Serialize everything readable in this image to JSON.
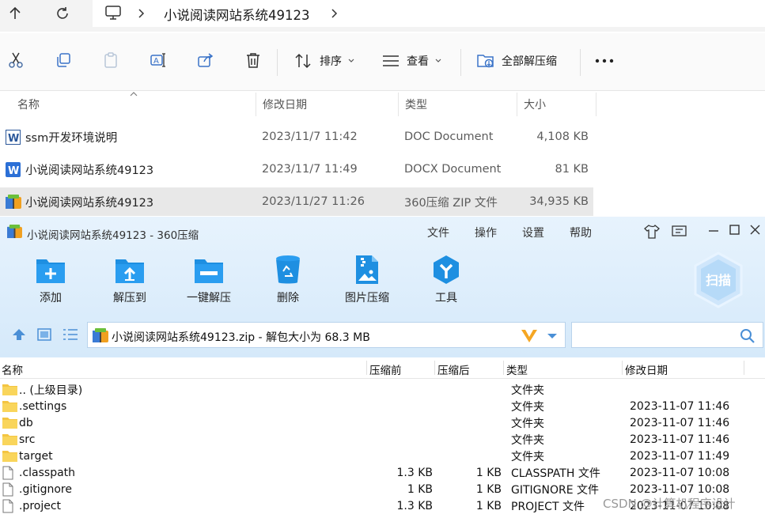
{
  "explorer": {
    "breadcrumb": [
      "小说阅读网站系统49123"
    ],
    "toolbar": {
      "sort_label": "排序",
      "view_label": "查看",
      "extract_all_label": "全部解压缩"
    },
    "columns": [
      "名称",
      "修改日期",
      "类型",
      "大小"
    ],
    "files": [
      {
        "name": "ssm开发环境说明",
        "date": "2023/11/7 11:42",
        "type": "DOC Document",
        "size": "4,108 KB",
        "icon": "word-doc-icon"
      },
      {
        "name": "小说阅读网站系统49123",
        "date": "2023/11/7 11:49",
        "type": "DOCX Document",
        "size": "81 KB",
        "icon": "word-docx-icon"
      },
      {
        "name": "小说阅读网站系统49123",
        "date": "2023/11/27 11:26",
        "type": "360压缩 ZIP 文件",
        "size": "34,935 KB",
        "icon": "zip-archive-icon"
      }
    ]
  },
  "zip": {
    "title": "小说阅读网站系统49123 - 360压缩",
    "menu": [
      "文件",
      "操作",
      "设置",
      "帮助"
    ],
    "tools": [
      "添加",
      "解压到",
      "一键解压",
      "删除",
      "图片压缩",
      "工具"
    ],
    "scan_label": "扫描",
    "path": "小说阅读网站系统49123.zip - 解包大小为 68.3 MB",
    "columns": [
      "名称",
      "压缩前",
      "压缩后",
      "类型",
      "修改日期"
    ],
    "rows": [
      {
        "name": ".. (上级目录)",
        "before": "",
        "after": "",
        "type": "文件夹",
        "date": "",
        "kind": "folder"
      },
      {
        "name": ".settings",
        "before": "",
        "after": "",
        "type": "文件夹",
        "date": "2023-11-07 11:46",
        "kind": "folder"
      },
      {
        "name": "db",
        "before": "",
        "after": "",
        "type": "文件夹",
        "date": "2023-11-07 11:46",
        "kind": "folder"
      },
      {
        "name": "src",
        "before": "",
        "after": "",
        "type": "文件夹",
        "date": "2023-11-07 11:46",
        "kind": "folder"
      },
      {
        "name": "target",
        "before": "",
        "after": "",
        "type": "文件夹",
        "date": "2023-11-07 11:49",
        "kind": "folder"
      },
      {
        "name": ".classpath",
        "before": "1.3 KB",
        "after": "1 KB",
        "type": "CLASSPATH 文件",
        "date": "2023-11-07 10:08",
        "kind": "file"
      },
      {
        "name": ".gitignore",
        "before": "1 KB",
        "after": "1 KB",
        "type": "GITIGNORE 文件",
        "date": "2023-11-07 10:08",
        "kind": "file"
      },
      {
        "name": ".project",
        "before": "1.3 KB",
        "after": "1 KB",
        "type": "PROJECT 文件",
        "date": "2023-11-07 10:08",
        "kind": "file"
      }
    ]
  },
  "watermark": "CSDN @计算机程序设计",
  "colors": {
    "accent": "#1e8fe1",
    "selection": "#e8e8e8",
    "zip_header": "#dcecfb"
  }
}
